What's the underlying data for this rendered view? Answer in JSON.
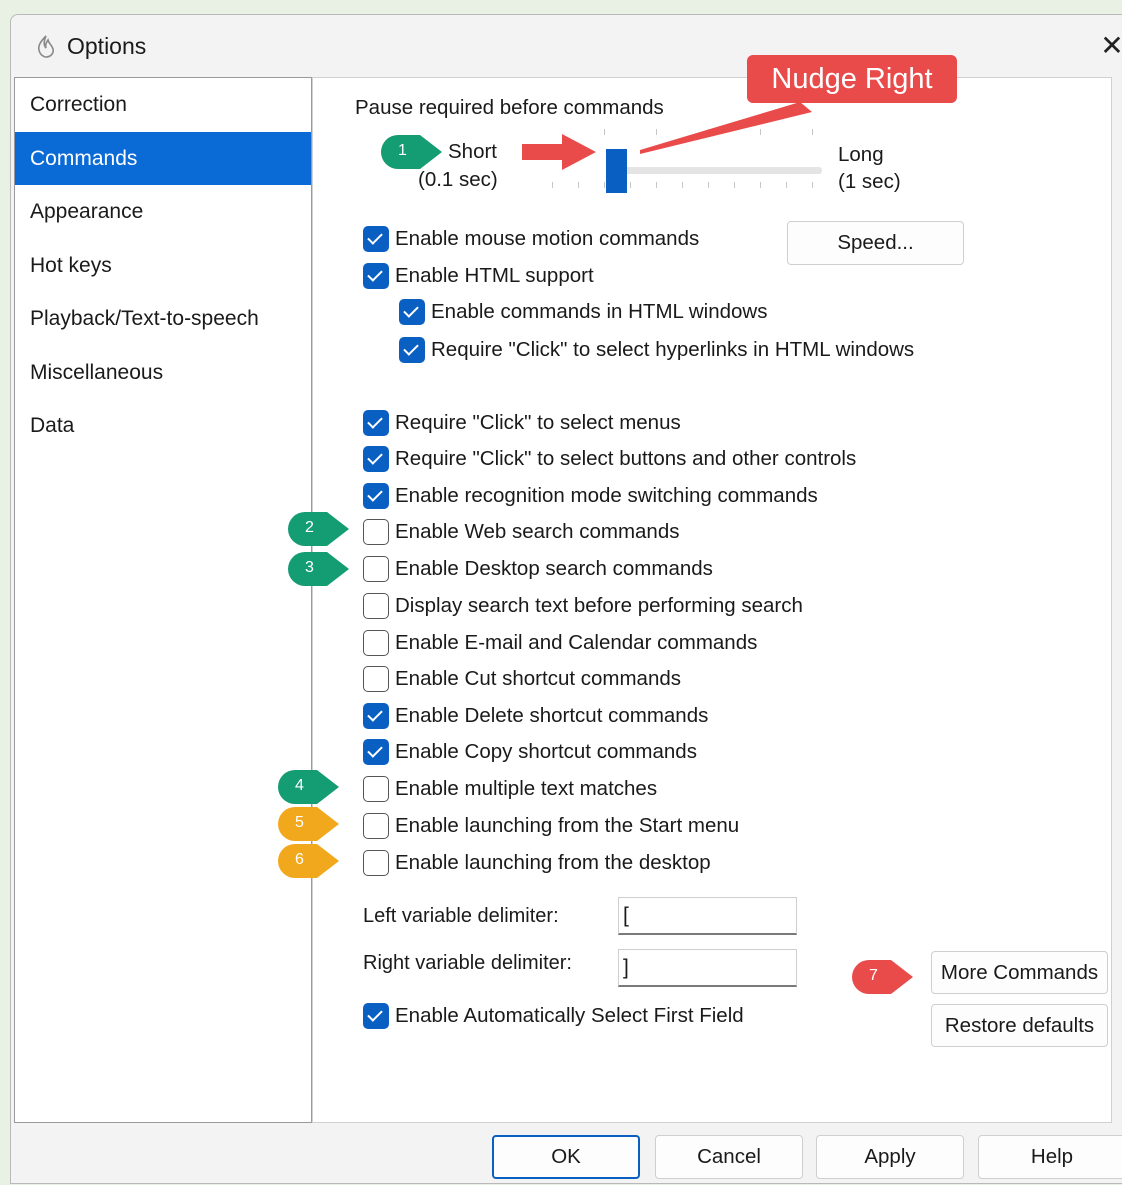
{
  "window": {
    "title": "Options"
  },
  "sidebar": {
    "items": [
      {
        "label": "Correction",
        "selected": false
      },
      {
        "label": "Commands",
        "selected": true
      },
      {
        "label": "Appearance",
        "selected": false
      },
      {
        "label": "Hot keys",
        "selected": false
      },
      {
        "label": "Playback/Text-to-speech",
        "selected": false
      },
      {
        "label": "Miscellaneous",
        "selected": false
      },
      {
        "label": "Data",
        "selected": false
      }
    ]
  },
  "pause": {
    "label": "Pause required before commands",
    "short_label": "Short",
    "short_value": "(0.1 sec)",
    "long_label": "Long",
    "long_value": "(1 sec)",
    "slider_level": 0.12
  },
  "checkboxes": {
    "mouse_motion": {
      "label": "Enable mouse motion commands",
      "checked": true
    },
    "html_support": {
      "label": "Enable HTML support",
      "checked": true
    },
    "html_commands": {
      "label": "Enable commands in HTML windows",
      "checked": true
    },
    "html_click": {
      "label": "Require \"Click\" to select hyperlinks in HTML windows",
      "checked": true
    },
    "click_menus": {
      "label": "Require \"Click\" to select menus",
      "checked": true
    },
    "click_buttons": {
      "label": "Require \"Click\" to select buttons and other controls",
      "checked": true
    },
    "recognition_mode": {
      "label": "Enable recognition mode switching commands",
      "checked": true
    },
    "web_search": {
      "label": "Enable Web search commands",
      "checked": false
    },
    "desktop_search": {
      "label": "Enable Desktop search commands",
      "checked": false
    },
    "display_search_text": {
      "label": "Display search text before performing search",
      "checked": false
    },
    "email_calendar": {
      "label": "Enable E-mail and Calendar commands",
      "checked": false
    },
    "cut_shortcut": {
      "label": "Enable Cut shortcut commands",
      "checked": false
    },
    "delete_shortcut": {
      "label": "Enable Delete shortcut commands",
      "checked": true
    },
    "copy_shortcut": {
      "label": "Enable Copy shortcut commands",
      "checked": true
    },
    "multiple_matches": {
      "label": "Enable multiple text matches",
      "checked": false
    },
    "launch_start_menu": {
      "label": "Enable launching from the Start menu",
      "checked": false
    },
    "launch_desktop": {
      "label": "Enable launching from the desktop",
      "checked": false
    },
    "auto_select_first": {
      "label": "Enable Automatically Select First Field",
      "checked": true
    }
  },
  "delimiters": {
    "left_label": "Left variable delimiter:",
    "left_value": "[",
    "right_label": "Right variable delimiter:",
    "right_value": "]"
  },
  "buttons": {
    "speed": "Speed...",
    "more_commands": "More Commands",
    "restore_defaults": "Restore defaults",
    "ok": "OK",
    "cancel": "Cancel",
    "apply": "Apply",
    "help": "Help"
  },
  "annotations": {
    "callout": "Nudge Right",
    "markers": [
      {
        "number": "1",
        "color": "#149c72"
      },
      {
        "number": "2",
        "color": "#149c72"
      },
      {
        "number": "3",
        "color": "#149c72"
      },
      {
        "number": "4",
        "color": "#149c72"
      },
      {
        "number": "5",
        "color": "#f2a81d"
      },
      {
        "number": "6",
        "color": "#f2a81d"
      },
      {
        "number": "7",
        "color": "#e94b4b"
      }
    ]
  },
  "icons": {
    "app": "flame-icon",
    "close": "close-icon",
    "check": "check-icon"
  }
}
